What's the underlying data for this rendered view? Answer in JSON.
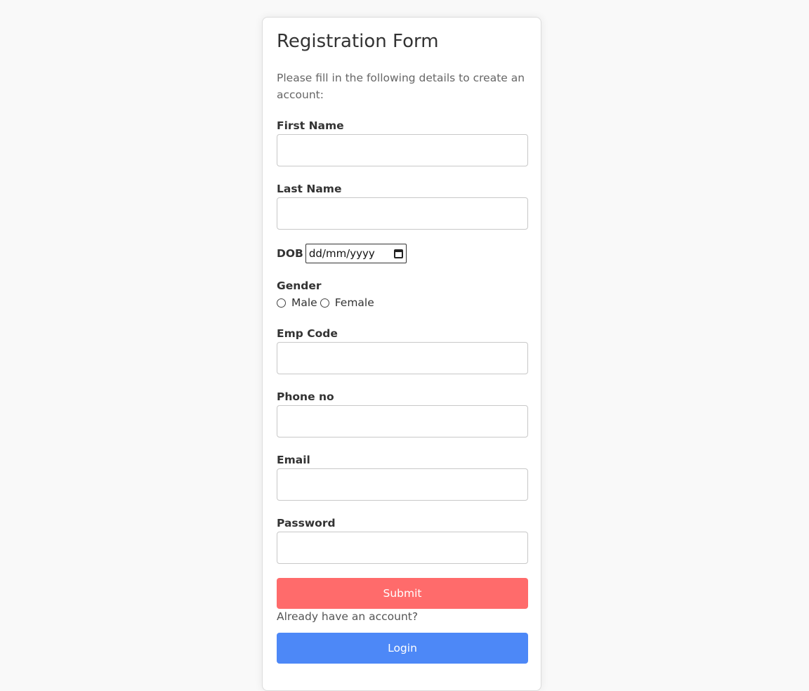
{
  "form": {
    "title": "Registration Form",
    "subtitle": "Please fill in the following details to create an account:",
    "fields": {
      "first_name": {
        "label": "First Name",
        "value": ""
      },
      "last_name": {
        "label": "Last Name",
        "value": ""
      },
      "dob": {
        "label": "DOB",
        "placeholder": "dd/mm/yyyy",
        "icon": "calendar-icon"
      },
      "gender": {
        "label": "Gender",
        "options": [
          "Male",
          "Female"
        ],
        "selected": null
      },
      "emp_code": {
        "label": "Emp Code",
        "value": ""
      },
      "phone": {
        "label": "Phone no",
        "value": ""
      },
      "email": {
        "label": "Email",
        "value": ""
      },
      "password": {
        "label": "Password",
        "value": ""
      }
    },
    "submit_label": "Submit",
    "already_text": "Already have an account?",
    "login_label": "Login"
  },
  "colors": {
    "background": "#f9f9f9",
    "card": "#ffffff",
    "submit": "#ff6b6b",
    "login": "#4d88f7"
  }
}
